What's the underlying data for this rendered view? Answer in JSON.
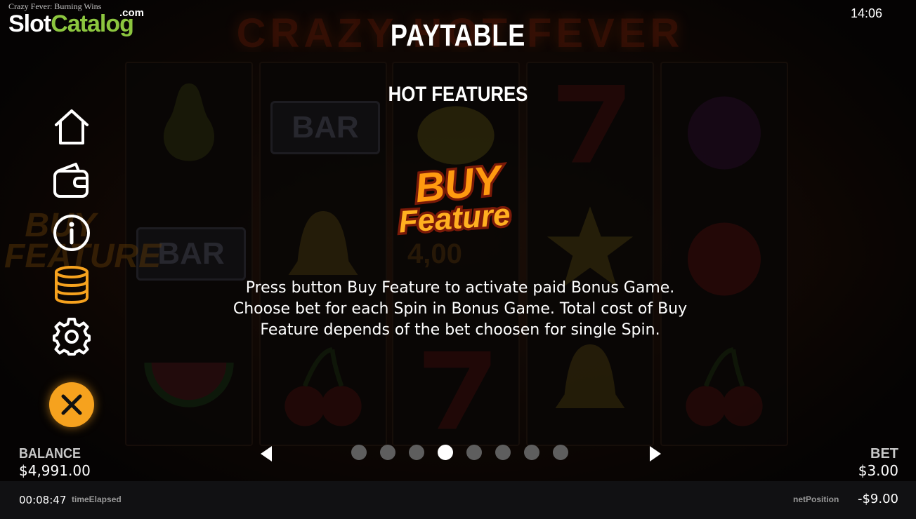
{
  "watermark": {
    "subtitle": "Crazy Fever: Burning Wins",
    "slot": "Slot",
    "catalog": "Catalog",
    "com": ".com"
  },
  "background": {
    "game_title": "CRAZY HOT FEVER",
    "bar_symbol": "BAR",
    "buy_text": "BUY FEATURE",
    "price_hint": "4,00"
  },
  "clock": "14:06",
  "paytable": {
    "title": "PAYTABLE",
    "section_title": "HOT FEATURES",
    "logo_line1": "BUY",
    "logo_line2": "Feature",
    "description": "Press button Buy Feature to activate paid Bonus Game. Choose bet for each Spin in Bonus Game. Total cost of Buy Feature depends of the bet choosen for single Spin."
  },
  "side_menu": [
    "home-icon",
    "wallet-icon",
    "info-icon",
    "coins-icon",
    "gear-icon",
    "close-icon"
  ],
  "colors": {
    "accent": "#f6a21e",
    "brand_green": "#8cc63f",
    "dot_inactive": "#5e5e5e",
    "dot_active": "#ffffff"
  },
  "pagination": {
    "total": 8,
    "active_index": 3
  },
  "balance": {
    "label": "BALANCE",
    "value": "$4,991.00"
  },
  "bet": {
    "label": "BET",
    "value": "$3.00"
  },
  "status_bar": {
    "time_elapsed": "00:08:47",
    "time_elapsed_label": "timeElapsed",
    "net_position_label": "netPosition",
    "net_position": "-$9.00"
  }
}
